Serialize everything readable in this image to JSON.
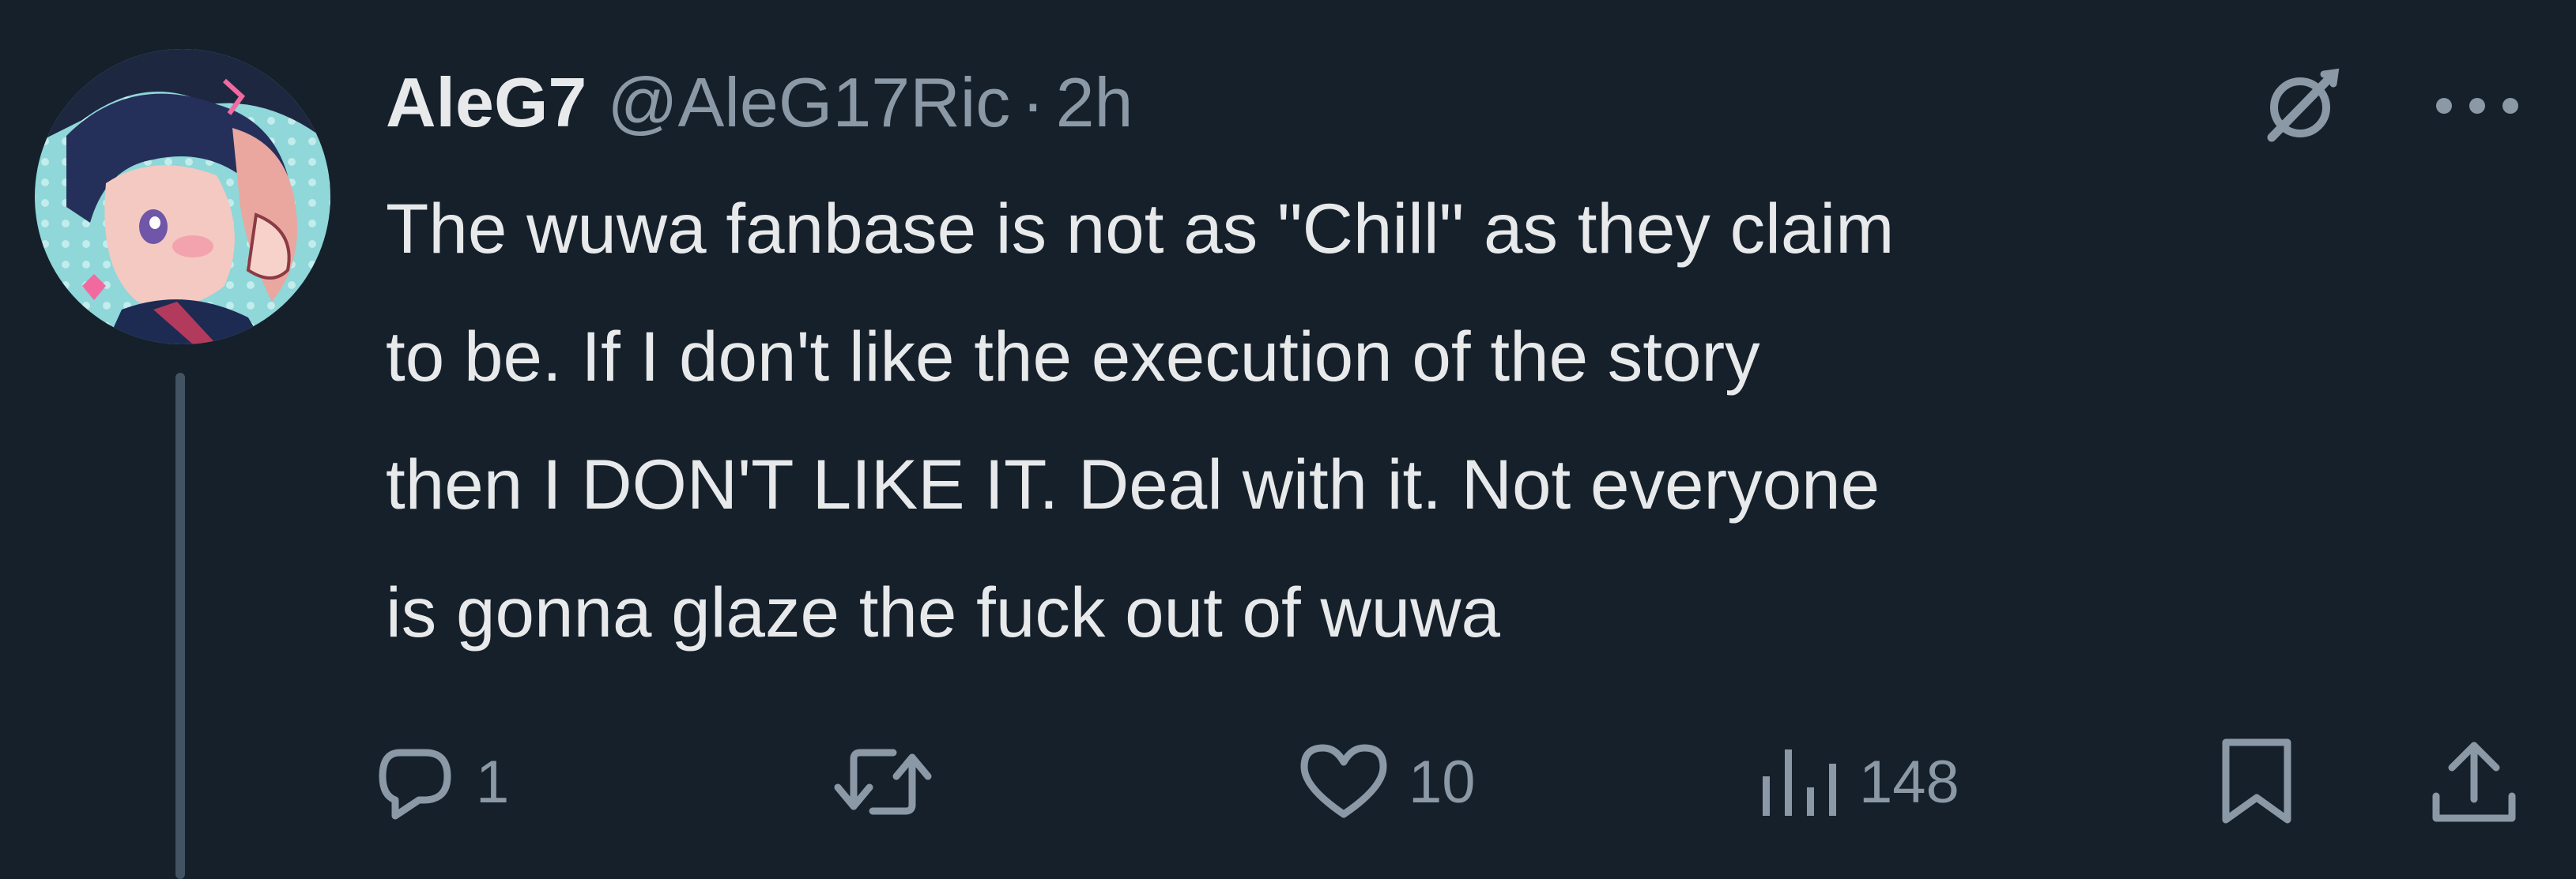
{
  "post": {
    "author": {
      "display_name": "AleG7",
      "handle": "@AleG17Ric",
      "separator": "·",
      "time": "2h"
    },
    "text": "The wuwa fanbase is not as \"Chill\" as they claim\nto be. If I don't like the execution of the story\nthen I DON'T LIKE IT. Deal with it. Not everyone\nis gonna glaze the fuck out of wuwa",
    "actions": {
      "replies": "1",
      "reposts": "",
      "likes": "10",
      "views": "148"
    }
  },
  "icons": {
    "grok": "grok-icon",
    "more": "more-icon",
    "reply": "reply-icon",
    "repost": "repost-icon",
    "like": "like-icon",
    "views": "views-icon",
    "bookmark": "bookmark-icon",
    "share": "share-icon"
  },
  "colors": {
    "background": "#15202b",
    "text_primary": "#e7e9ea",
    "text_secondary": "#8b98a5",
    "thread_line": "#425364"
  }
}
